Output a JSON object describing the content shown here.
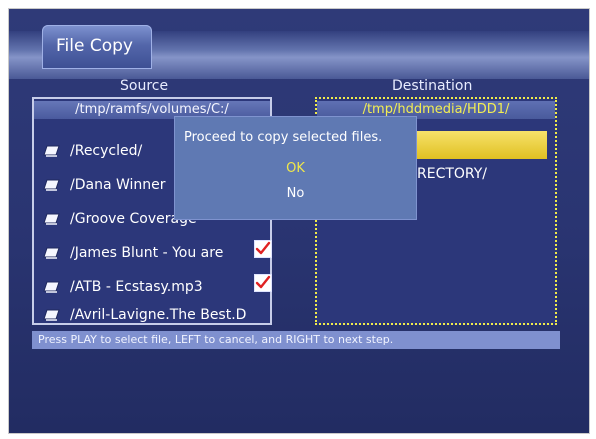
{
  "window": {
    "title": "File Copy"
  },
  "labels": {
    "source": "Source",
    "destination": "Destination"
  },
  "source": {
    "path": "/tmp/ramfs/volumes/C:/",
    "files": [
      {
        "name": "/Recycled/",
        "checked": false
      },
      {
        "name": "/Dana Winner",
        "checked": false
      },
      {
        "name": "/Groove Coverage",
        "checked": false
      },
      {
        "name": "/James Blunt - You are",
        "checked": true
      },
      {
        "name": "/ATB - Ecstasy.mp3",
        "checked": true
      },
      {
        "name": "/Avril-Lavigne.The Best.D",
        "checked": false
      }
    ]
  },
  "destination": {
    "path": "/tmp/hddmedia/HDD1/",
    "highlight_label": "",
    "directory_label": "RECTORY/"
  },
  "status_text": "Press PLAY to select file, LEFT to cancel, and RIGHT to next step.",
  "dialog": {
    "message": "Proceed to copy selected files.",
    "ok_label": "OK",
    "no_label": "No"
  },
  "colors": {
    "background": "#2f3a78",
    "dialog": "#5f79b3",
    "highlight": "#e8c83a",
    "accent_text": "#f0e74a"
  }
}
